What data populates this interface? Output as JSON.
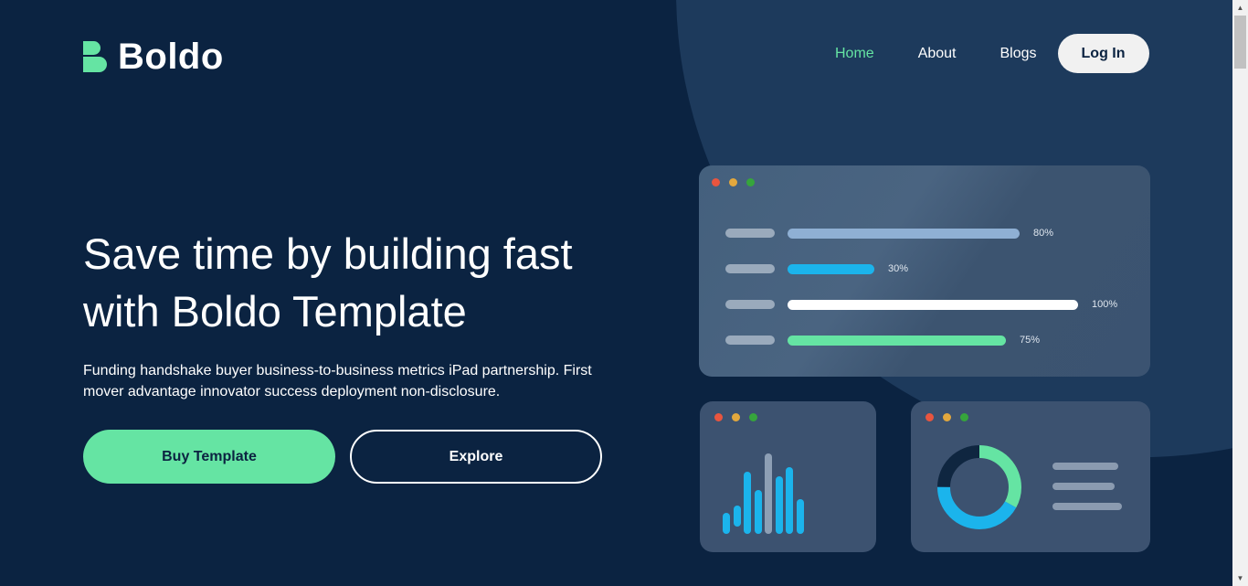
{
  "brand": {
    "name": "Boldo",
    "logo_icon": "boldo-b-logo",
    "accent": "#65e4a3"
  },
  "nav": {
    "items": [
      {
        "label": "Home",
        "active": true
      },
      {
        "label": "About",
        "active": false
      },
      {
        "label": "Blogs",
        "active": false
      }
    ],
    "login_label": "Log In"
  },
  "hero": {
    "title_line1": "Save time by building fast",
    "title_line2": "with Boldo Template",
    "description": "Funding handshake buyer business-to-business metrics iPad partnership. First mover advantage innovator success deployment non-disclosure.",
    "buy_label": "Buy Template",
    "explore_label": "Explore"
  },
  "colors": {
    "background": "#0b2341",
    "window_red": "#e9553f",
    "window_yellow": "#e3a83d",
    "window_green": "#36a53c"
  },
  "illustration": {
    "progress_rows": [
      {
        "value": 0.8,
        "label": "80%",
        "color": "#8fb0d4"
      },
      {
        "value": 0.3,
        "label": "30%",
        "color": "#1bb4ec"
      },
      {
        "value": 1.0,
        "label": "100%",
        "color": "#ffffff"
      },
      {
        "value": 0.75,
        "label": "75%",
        "color": "#65e4a3"
      }
    ],
    "bar_chart": {
      "values": [
        2,
        2,
        6.5,
        4.5,
        8.5,
        6,
        7,
        3.5
      ],
      "colors": [
        "#1bb4ec",
        "#1bb4ec",
        "#1bb4ec",
        "#1bb4ec",
        "#8d9fb5",
        "#1bb4ec",
        "#1bb4ec",
        "#1bb4ec"
      ]
    },
    "donut": {
      "segments": [
        {
          "value": 0.33,
          "color": "#65e4a3"
        },
        {
          "value": 0.42,
          "color": "#1bb4ec"
        },
        {
          "value": 0.25,
          "color": "#0f2640"
        }
      ]
    }
  }
}
